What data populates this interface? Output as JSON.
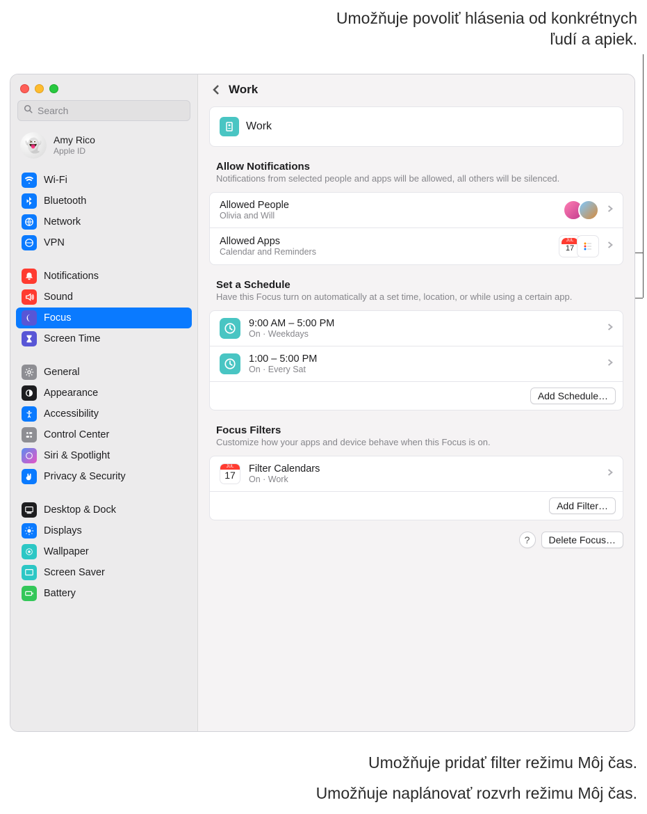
{
  "callouts": {
    "top": "Umožňuje povoliť hlásenia od konkrétnych ľudí a apiek.",
    "mid": "Umožňuje pridať filter režimu Môj čas.",
    "bot": "Umožňuje naplánovať rozvrh režimu Môj čas."
  },
  "search": {
    "placeholder": "Search"
  },
  "account": {
    "name": "Amy Rico",
    "sub": "Apple ID"
  },
  "sidebar": {
    "g1": [
      {
        "label": "Wi-Fi",
        "color": "#0a7aff"
      },
      {
        "label": "Bluetooth",
        "color": "#0a7aff"
      },
      {
        "label": "Network",
        "color": "#0a7aff"
      },
      {
        "label": "VPN",
        "color": "#0a7aff"
      }
    ],
    "g2": [
      {
        "label": "Notifications",
        "color": "#ff3b30"
      },
      {
        "label": "Sound",
        "color": "#ff3b30"
      },
      {
        "label": "Focus",
        "color": "#5856d6"
      },
      {
        "label": "Screen Time",
        "color": "#5856d6"
      }
    ],
    "g3": [
      {
        "label": "General",
        "color": "#8e8e93"
      },
      {
        "label": "Appearance",
        "color": "#1d1d1f"
      },
      {
        "label": "Accessibility",
        "color": "#0a7aff"
      },
      {
        "label": "Control Center",
        "color": "#8e8e93"
      },
      {
        "label": "Siri & Spotlight",
        "color": "linear-gradient(135deg,#3b82f6,#ec4899)"
      },
      {
        "label": "Privacy & Security",
        "color": "#0a7aff"
      }
    ],
    "g4": [
      {
        "label": "Desktop & Dock",
        "color": "#1d1d1f"
      },
      {
        "label": "Displays",
        "color": "#0a7aff"
      },
      {
        "label": "Wallpaper",
        "color": "#2cc7c5"
      },
      {
        "label": "Screen Saver",
        "color": "#2cc7c5"
      },
      {
        "label": "Battery",
        "color": "#34c759"
      }
    ]
  },
  "header": {
    "title": "Work"
  },
  "focusName": "Work",
  "allow": {
    "title": "Allow Notifications",
    "sub": "Notifications from selected people and apps will be allowed, all others will be silenced.",
    "people": {
      "title": "Allowed People",
      "sub": "Olivia and Will"
    },
    "apps": {
      "title": "Allowed Apps",
      "sub": "Calendar and Reminders"
    }
  },
  "schedule": {
    "title": "Set a Schedule",
    "sub": "Have this Focus turn on automatically at a set time, location, or while using a certain app.",
    "items": [
      {
        "title": "9:00 AM – 5:00 PM",
        "sub": "On · Weekdays"
      },
      {
        "title": "1:00 – 5:00 PM",
        "sub": "On · Every Sat"
      }
    ],
    "addBtn": "Add Schedule…"
  },
  "filters": {
    "title": "Focus Filters",
    "sub": "Customize how your apps and device behave when this Focus is on.",
    "item": {
      "title": "Filter Calendars",
      "sub": "On · Work"
    },
    "addBtn": "Add Filter…"
  },
  "deleteBtn": "Delete Focus…",
  "helpGlyph": "?",
  "calDay": "17",
  "calMonth": "JUL"
}
